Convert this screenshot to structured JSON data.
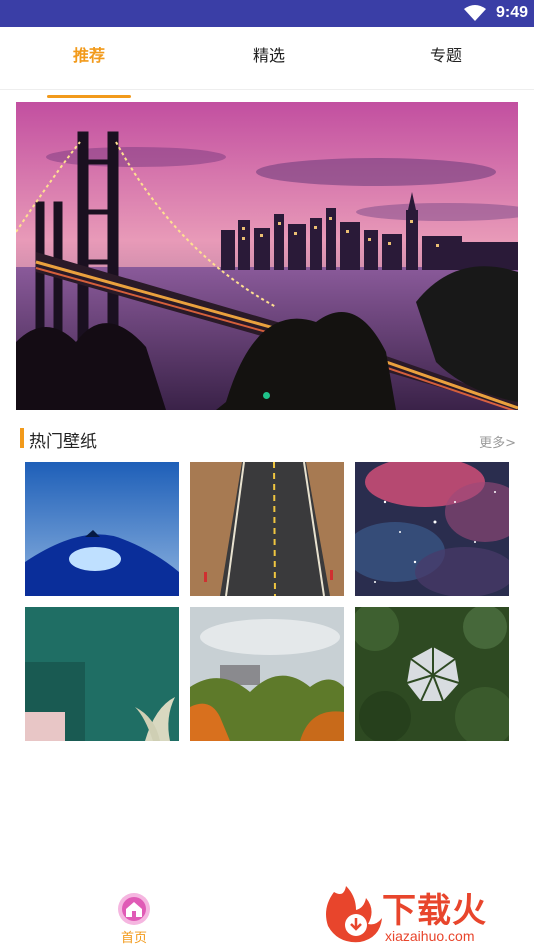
{
  "status_bar": {
    "time": "9:49",
    "icons": [
      "wifi-icon",
      "battery-icon"
    ]
  },
  "tabs": [
    {
      "label": "推荐",
      "active": true
    },
    {
      "label": "精选",
      "active": false
    },
    {
      "label": "专题",
      "active": false
    }
  ],
  "banner": {
    "image": "bridge-city-night",
    "page_count": 1,
    "active_page": 1
  },
  "hot_section": {
    "title": "热门壁纸",
    "more_label": "更多>"
  },
  "wallpapers": [
    {
      "name": "tent-night"
    },
    {
      "name": "desert-road"
    },
    {
      "name": "nebula-space"
    },
    {
      "name": "green-wall-room"
    },
    {
      "name": "autumn-trees"
    },
    {
      "name": "forest-aerial"
    }
  ],
  "bottom_nav": {
    "home_label": "首页",
    "home_icon": "home-icon"
  },
  "watermark": {
    "text": "下载火",
    "url": "xiazaihuo.com",
    "color": "#e8452c"
  },
  "colors": {
    "accent": "#f29a1b",
    "status_bar": "#3a3ea6",
    "dot": "#1fc28a"
  }
}
